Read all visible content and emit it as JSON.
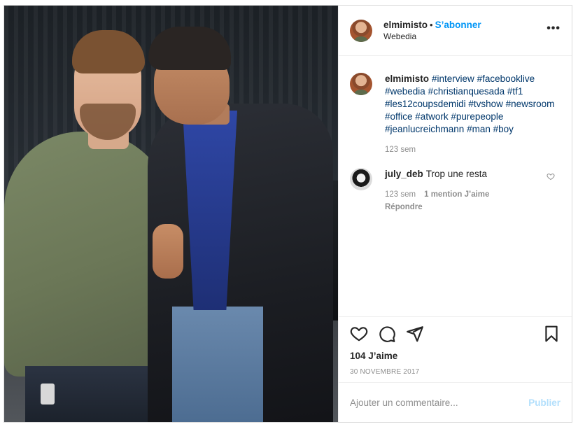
{
  "post": {
    "header": {
      "username": "elmimisto",
      "separator": "•",
      "follow_label": "S’abonner",
      "location": "Webedia",
      "more_label": "•••"
    },
    "caption": {
      "username": "elmimisto",
      "hashtags": [
        "#interview",
        "#facebooklive",
        "#webedia",
        "#christianquesada",
        "#tf1",
        "#les12coupsdemidi",
        "#tvshow",
        "#newsroom",
        "#office",
        "#atwork",
        "#purepeople",
        "#jeanlucreichmann",
        "#man",
        "#boy"
      ],
      "time": "123 sem"
    },
    "comment": {
      "username": "july_deb",
      "text": "Trop une resta",
      "time": "123 sem",
      "likes": "1 mention J’aime",
      "reply_label": "Répondre"
    },
    "likes": "104 J’aime",
    "date": "30 NOVEMBRE 2017",
    "add_comment": {
      "placeholder": "Ajouter un commentaire...",
      "publish_label": "Publier"
    }
  },
  "colors": {
    "accent": "#0095f6",
    "hashtag": "#00376b",
    "muted": "#8e8e8e",
    "border": "#dbdbdb",
    "publish_disabled": "#b2dffc"
  },
  "icons": [
    "heart-icon",
    "comment-icon",
    "share-icon",
    "bookmark-icon",
    "more-options-icon"
  ]
}
